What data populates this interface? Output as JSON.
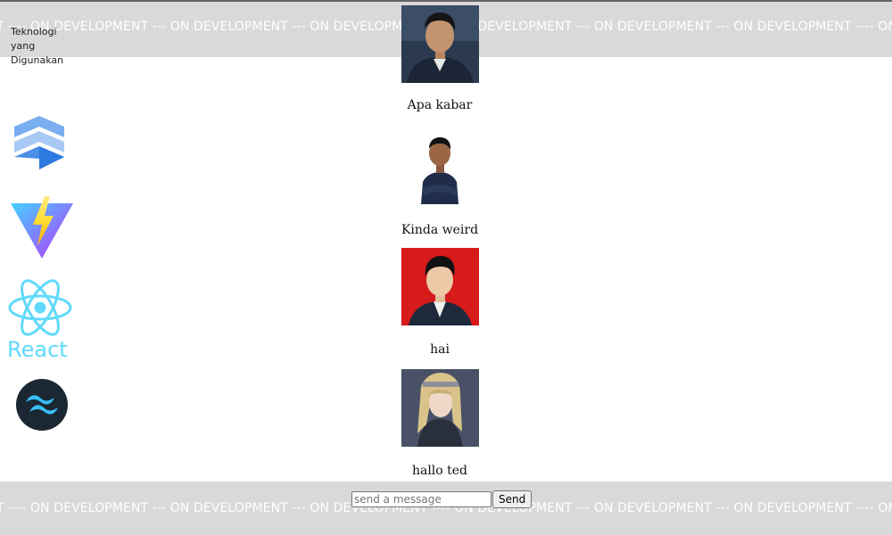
{
  "banner": {
    "top_text": "MENT ---- ON DEVELOPMENT --- ON DEVELOPMENT --- ON DEVELOPMENT ---- ON DEVELOPMENT --- ON DEVELOPMENT --- ON DEVELOPMENT ---- ON",
    "bottom_text": "MENT ---- ON DEVELOPMENT --- ON DEVELOPMENT --- ON DEVELOPMENT ---- ON DEVELOPMENT --- ON DEVELOPMENT --- ON DEVELOPMENT ---- ON"
  },
  "sidebar": {
    "title": "Teknologi yang Digunakan",
    "technologies": [
      {
        "name": "flutter-logo-icon"
      },
      {
        "name": "vite-logo-icon"
      },
      {
        "name": "react-logo-icon",
        "label": "React"
      },
      {
        "name": "tailwind-logo-icon"
      }
    ]
  },
  "messages": [
    {
      "text": "Apa kabar",
      "avatar": "avatar-man-dark-suit"
    },
    {
      "text": "Kinda weird",
      "avatar": "avatar-man-arms-crossed"
    },
    {
      "text": "hai",
      "avatar": "avatar-man-red-background"
    },
    {
      "text": "hallo ted",
      "avatar": "avatar-anime-character"
    }
  ],
  "composer": {
    "placeholder": "send a message",
    "send_label": "Send"
  }
}
